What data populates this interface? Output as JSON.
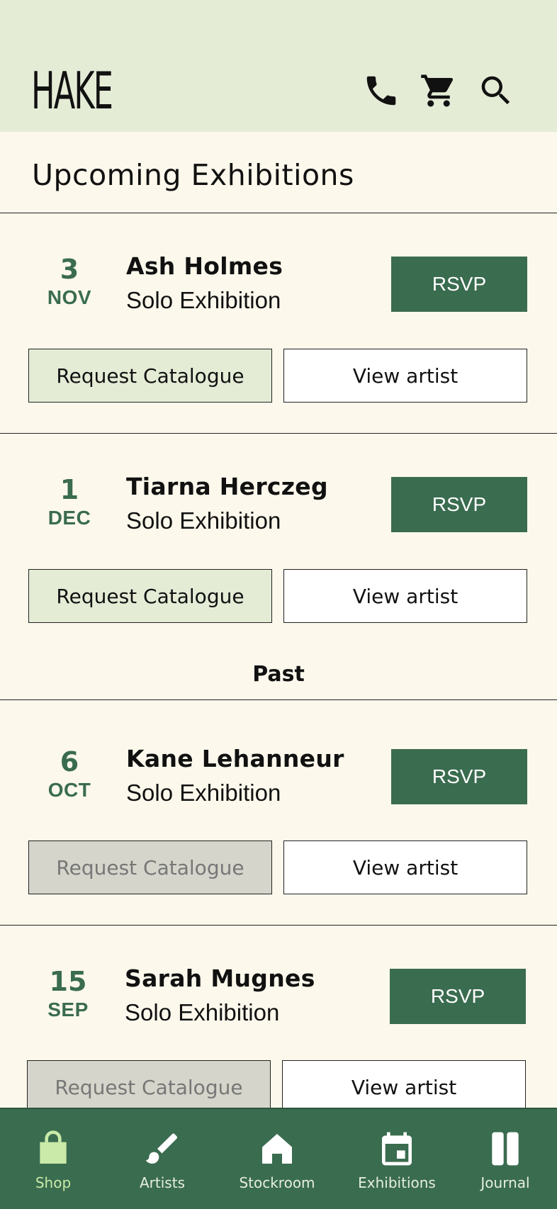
{
  "header": {
    "logo": "HAKE",
    "icons": [
      "phone-icon",
      "cart-icon",
      "search-icon"
    ]
  },
  "page_title": "Upcoming Exhibitions",
  "upcoming": [
    {
      "day": "3",
      "month": "NOV",
      "artist": "Ash Holmes",
      "type": "Solo Exhibition",
      "rsvp": "RSVP",
      "catalogue": "Request Catalogue",
      "view": "View artist"
    },
    {
      "day": "1",
      "month": "DEC",
      "artist": "Tiarna Herczeg",
      "type": "Solo Exhibition",
      "rsvp": "RSVP",
      "catalogue": "Request Catalogue",
      "view": "View artist"
    }
  ],
  "past_label": "Past",
  "past": [
    {
      "day": "6",
      "month": "OCT",
      "artist": "Kane Lehanneur",
      "type": "Solo Exhibition",
      "rsvp": "RSVP",
      "catalogue": "Request Catalogue",
      "view": "View artist"
    },
    {
      "day": "15",
      "month": "SEP",
      "artist": "Sarah Mugnes",
      "type": "Solo Exhibition",
      "rsvp": "RSVP",
      "catalogue": "Request Catalogue",
      "view": "View artist"
    }
  ],
  "nav": [
    {
      "label": "Shop",
      "icon": "shopping-bag-icon",
      "active": true
    },
    {
      "label": "Artists",
      "icon": "paintbrush-icon"
    },
    {
      "label": "Stockroom",
      "icon": "home-icon"
    },
    {
      "label": "Exhibitions",
      "icon": "calendar-icon"
    },
    {
      "label": "Journal",
      "icon": "book-icon"
    }
  ],
  "colors": {
    "header_bg": "#e4ecd6",
    "page_bg": "#fcf8ec",
    "accent_green": "#3a6c4f",
    "disabled_bg": "#d5d5cb",
    "active_nav": "#c9eaa8"
  }
}
